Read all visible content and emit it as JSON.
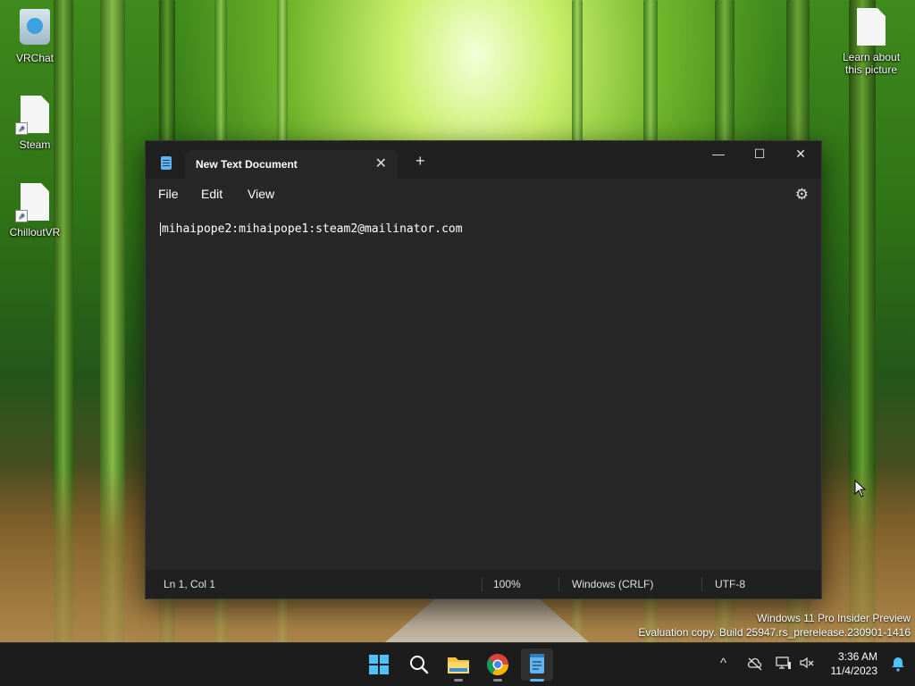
{
  "desktop": {
    "icons": [
      {
        "label": "VRChat",
        "icon": "recycle-bin-icon"
      },
      {
        "label": "Steam",
        "icon": "file-shortcut-icon"
      },
      {
        "label": "ChilloutVR",
        "icon": "file-shortcut-icon"
      },
      {
        "label": "Learn about this picture",
        "icon": "file-icon"
      }
    ]
  },
  "notepad": {
    "tab_title": "New Text Document",
    "tab_close": "✕",
    "tab_add": "+",
    "window_controls": {
      "minimize": "—",
      "maximize": "☐",
      "close": "✕"
    },
    "menu": [
      "File",
      "Edit",
      "View"
    ],
    "settings_icon": "⚙",
    "content": "mihaipope2:mihaipope1:steam2@mailinator.com",
    "status": {
      "position": "Ln 1, Col 1",
      "zoom": "100%",
      "line_ending": "Windows (CRLF)",
      "encoding": "UTF-8"
    }
  },
  "watermark": {
    "line1": "Windows 11 Pro Insider Preview",
    "line2": "Evaluation copy. Build 25947.rs_prerelease.230901-1416"
  },
  "taskbar": {
    "apps": [
      "start-button",
      "search-button",
      "file-explorer",
      "chrome",
      "notepad"
    ],
    "tray": {
      "chevron": "^"
    },
    "clock": {
      "time": "3:36 AM",
      "date": "11/4/2023"
    }
  },
  "colors": {
    "accent": "#5fb6f0",
    "window_bg": "#272727",
    "taskbar_bg": "#1c1c1c"
  }
}
